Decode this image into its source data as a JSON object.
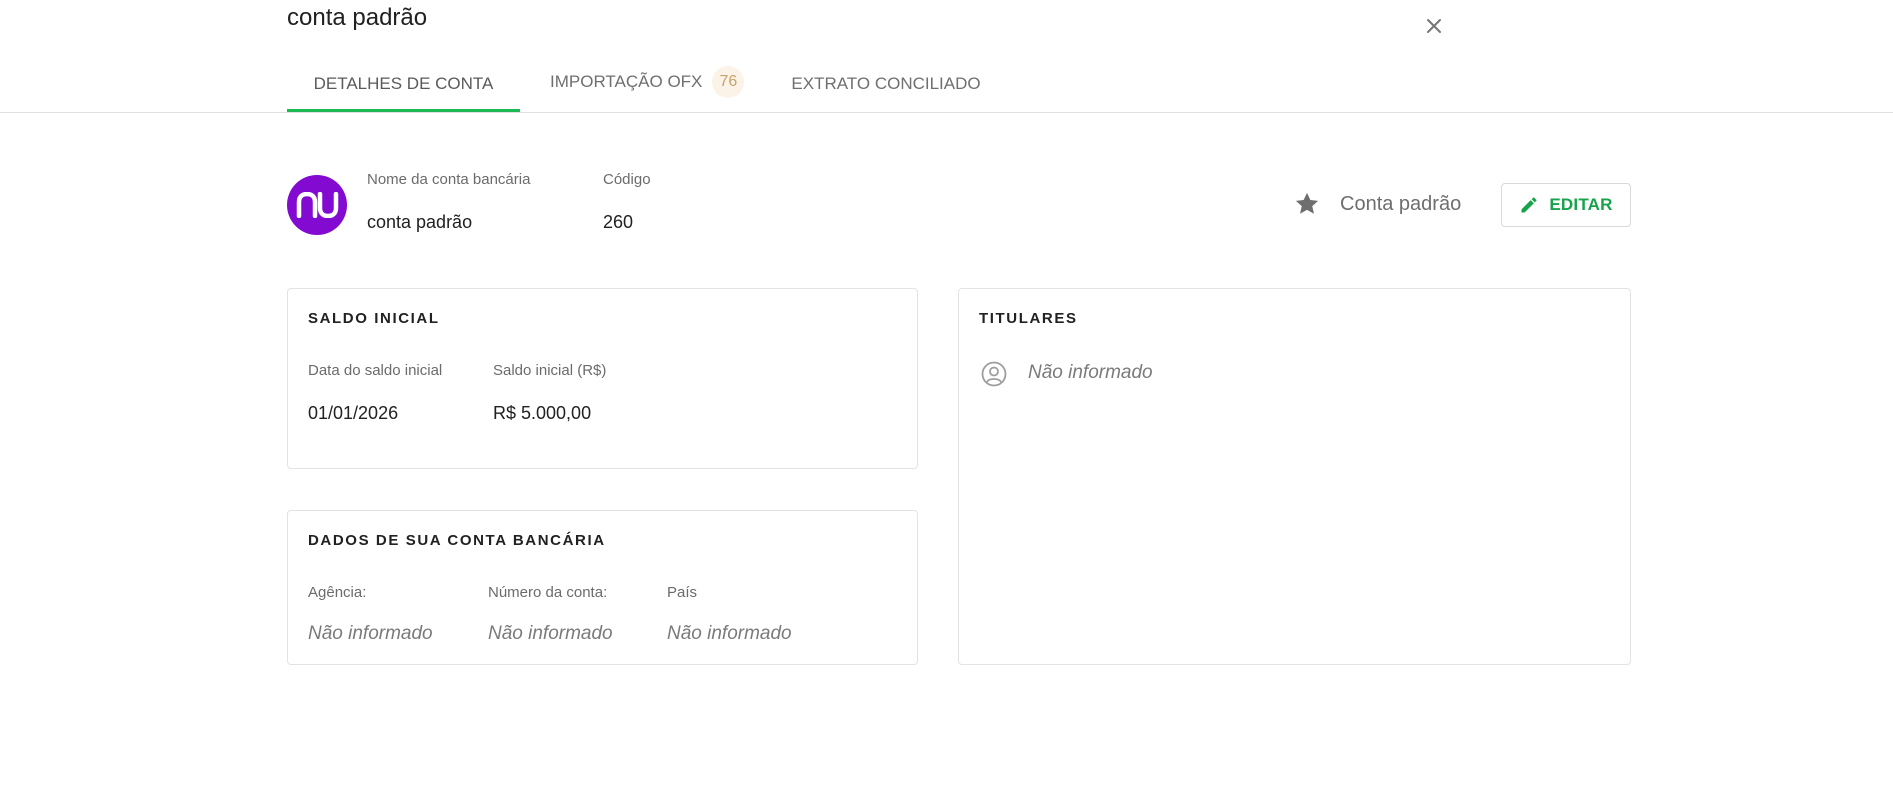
{
  "header": {
    "title": "conta padrão",
    "close_icon": "close-icon"
  },
  "tabs": [
    {
      "label": "DETALHES DE CONTA",
      "active": true
    },
    {
      "label": "IMPORTAÇÃO OFX",
      "badge": "76",
      "active": false
    },
    {
      "label": "EXTRATO CONCILIADO",
      "active": false
    }
  ],
  "account": {
    "logo_icon": "nubank-logo",
    "name_label": "Nome da conta bancária",
    "name_value": "conta padrão",
    "code_label": "Código",
    "code_value": "260",
    "favorite_icon": "star-icon",
    "favorite_label": "Conta padrão",
    "edit_label": "EDITAR",
    "edit_icon": "pencil-icon"
  },
  "saldo_inicial": {
    "title": "SALDO INICIAL",
    "date_label": "Data do saldo inicial",
    "date_value": "01/01/2026",
    "amount_label": "Saldo inicial (R$)",
    "amount_value": "R$ 5.000,00"
  },
  "dados_conta": {
    "title": "DADOS DE SUA CONTA BANCÁRIA",
    "agencia_label": "Agência:",
    "agencia_value": "Não informado",
    "numero_label": "Número da conta:",
    "numero_value": "Não informado",
    "pais_label": "País",
    "pais_value": "Não informado"
  },
  "titulares": {
    "title": "TITULARES",
    "icon": "person-circle-icon",
    "value": "Não informado"
  },
  "colors": {
    "accent_green": "#1db954",
    "edit_green": "#17a34a",
    "nubank_purple": "#820ad1",
    "badge_bg": "#fbf3e8",
    "badge_text": "#caa26e"
  }
}
